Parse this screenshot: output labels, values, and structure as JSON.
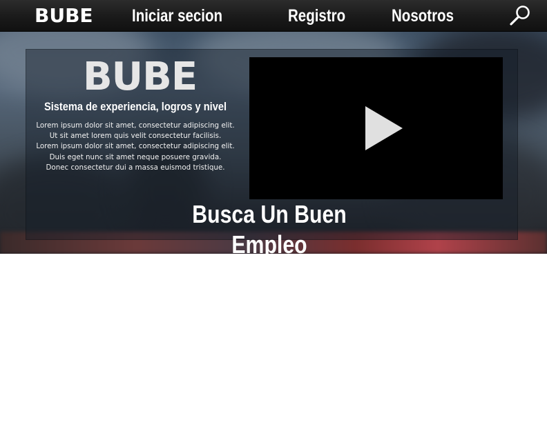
{
  "navbar": {
    "logo": "BUBE",
    "links": {
      "login": "Iniciar secion",
      "register": "Registro",
      "about": "Nosotros"
    },
    "search_icon": "search-icon"
  },
  "hero": {
    "logo": "BUBE",
    "subtitle": "Sistema de experiencia, logros y nivel",
    "body_lines": [
      "Lorem ipsum dolor sit amet, consectetur adipiscing elit.",
      "Ut sit amet lorem quis velit consectetur facilisis.",
      "Lorem ipsum dolor sit amet, consectetur adipiscing elit.",
      "Duis eget nunc sit amet neque posuere gravida.",
      "Donec consectetur dui a massa euismod tristique."
    ],
    "video_icon": "play-icon",
    "tagline": "Busca Un Buen Empleo"
  },
  "colors": {
    "navbar_bg": "#1f1f1f",
    "text": "#ffffff",
    "video_bg": "#000000",
    "play_icon": "#e0e0e0"
  }
}
